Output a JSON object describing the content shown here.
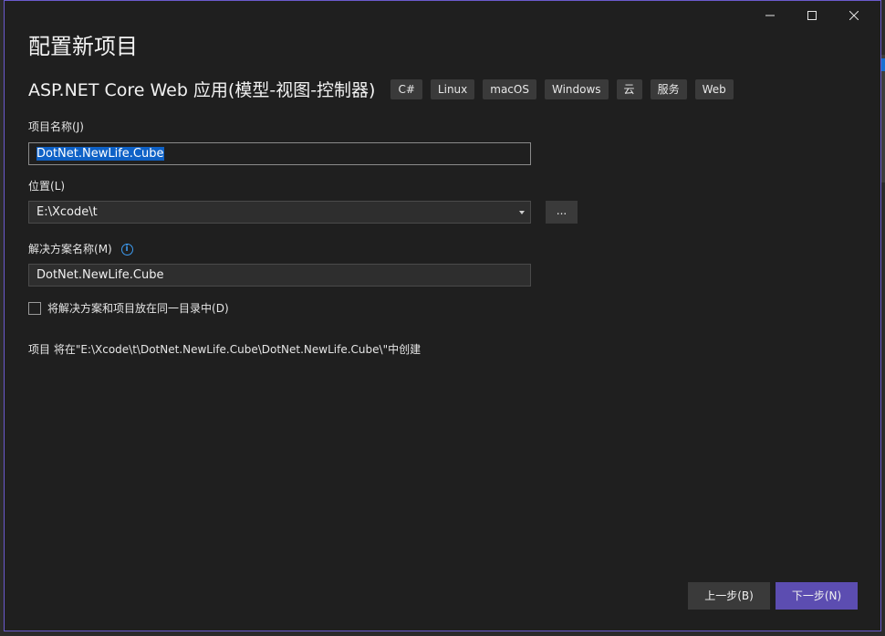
{
  "window": {
    "minimize_label": "—",
    "maximize_label": "☐",
    "close_label": "✕"
  },
  "page_title": "配置新项目",
  "template": {
    "name": "ASP.NET Core Web 应用(模型-视图-控制器)",
    "tags": [
      "C#",
      "Linux",
      "macOS",
      "Windows",
      "云",
      "服务",
      "Web"
    ]
  },
  "project_name": {
    "label": "项目名称",
    "accesskey_label": "(J)",
    "value": "DotNet.NewLife.Cube"
  },
  "location": {
    "label": "位置",
    "accesskey_label": "(L)",
    "value": "E:\\Xcode\\t",
    "browse_label": "..."
  },
  "solution_name": {
    "label": "解决方案名称",
    "accesskey_label": "(M)",
    "info_icon": "i",
    "value": "DotNet.NewLife.Cube"
  },
  "same_dir_checkbox": {
    "label": "将解决方案和项目放在同一目录中",
    "accesskey_label": "(D)",
    "checked": false
  },
  "path_info": "项目 将在\"E:\\Xcode\\t\\DotNet.NewLife.Cube\\DotNet.NewLife.Cube\\\"中创建",
  "buttons": {
    "back_label": "上一步",
    "back_accesskey": "(B)",
    "next_label": "下一步",
    "next_accesskey": "(N)"
  },
  "colors": {
    "accent": "#5c4db1",
    "background": "#1f1f1f",
    "selection": "#0e61c6"
  }
}
